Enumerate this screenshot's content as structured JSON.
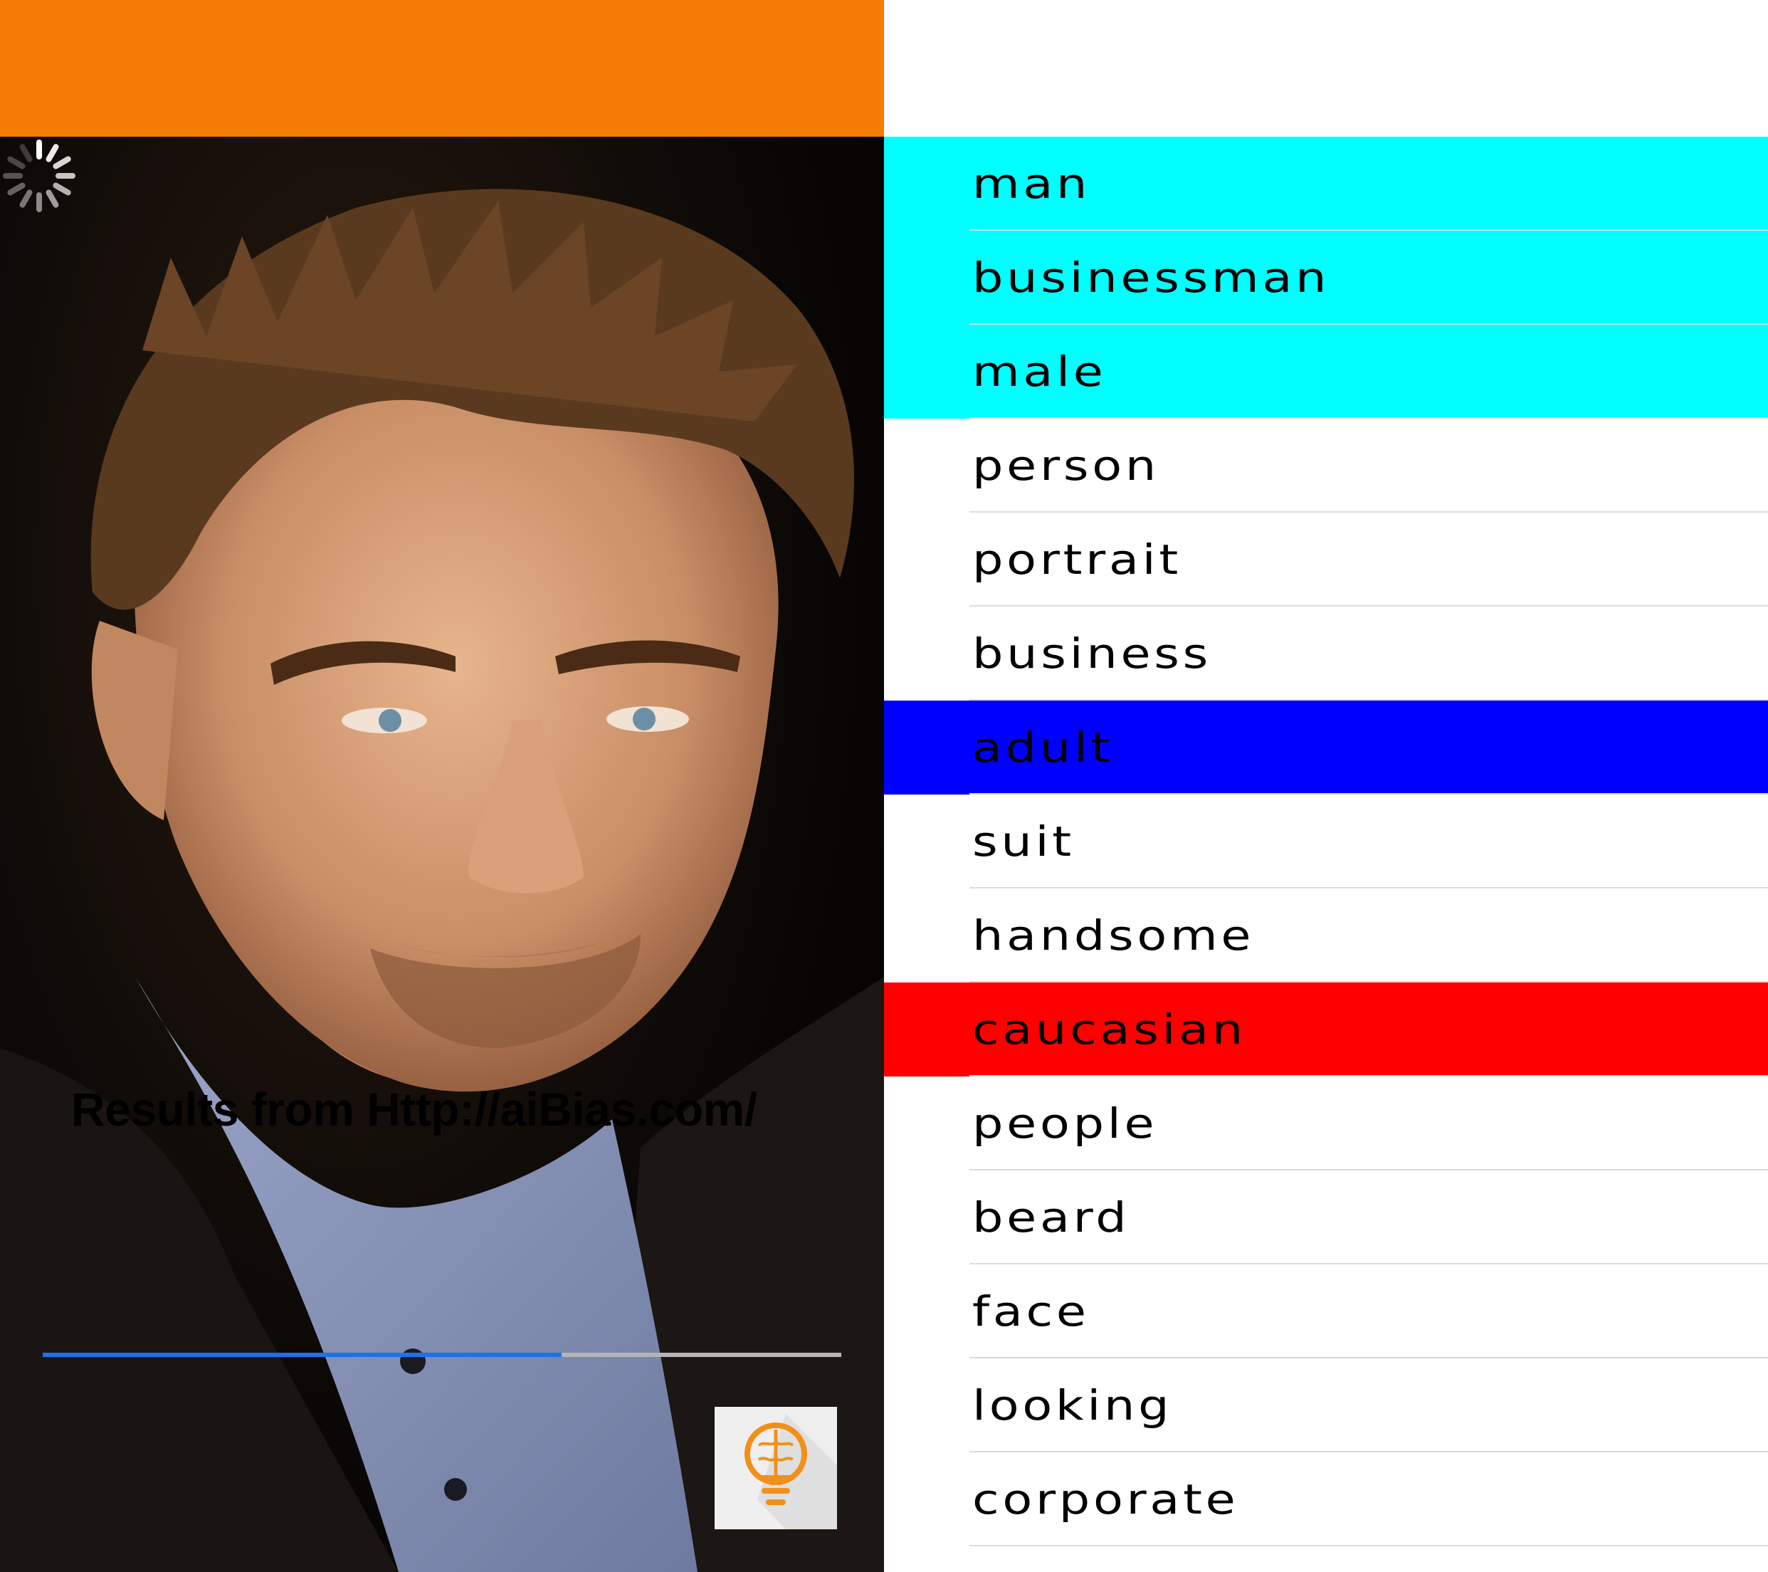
{
  "colors": {
    "header_orange": "#f57c04",
    "progress_blue": "#1a73e8",
    "progress_track": "#b5b5b5",
    "icon_orange": "#f0901a"
  },
  "overlay": {
    "results_text": "Results from Http://aiBias.com/",
    "progress": 0.65,
    "loading_icon": "spinner-icon",
    "app_icon": "brain-lightbulb-icon"
  },
  "tags": [
    {
      "label": "man",
      "highlight": "#00ffff"
    },
    {
      "label": "businessman",
      "highlight": "#00ffff"
    },
    {
      "label": "male",
      "highlight": "#00ffff"
    },
    {
      "label": "person",
      "highlight": ""
    },
    {
      "label": "portrait",
      "highlight": ""
    },
    {
      "label": "business",
      "highlight": ""
    },
    {
      "label": "adult",
      "highlight": "#0000ff"
    },
    {
      "label": "suit",
      "highlight": ""
    },
    {
      "label": "handsome",
      "highlight": ""
    },
    {
      "label": "caucasian",
      "highlight": "#ff0000"
    },
    {
      "label": "people",
      "highlight": ""
    },
    {
      "label": "beard",
      "highlight": ""
    },
    {
      "label": "face",
      "highlight": ""
    },
    {
      "label": "looking",
      "highlight": ""
    },
    {
      "label": "corporate",
      "highlight": ""
    }
  ]
}
